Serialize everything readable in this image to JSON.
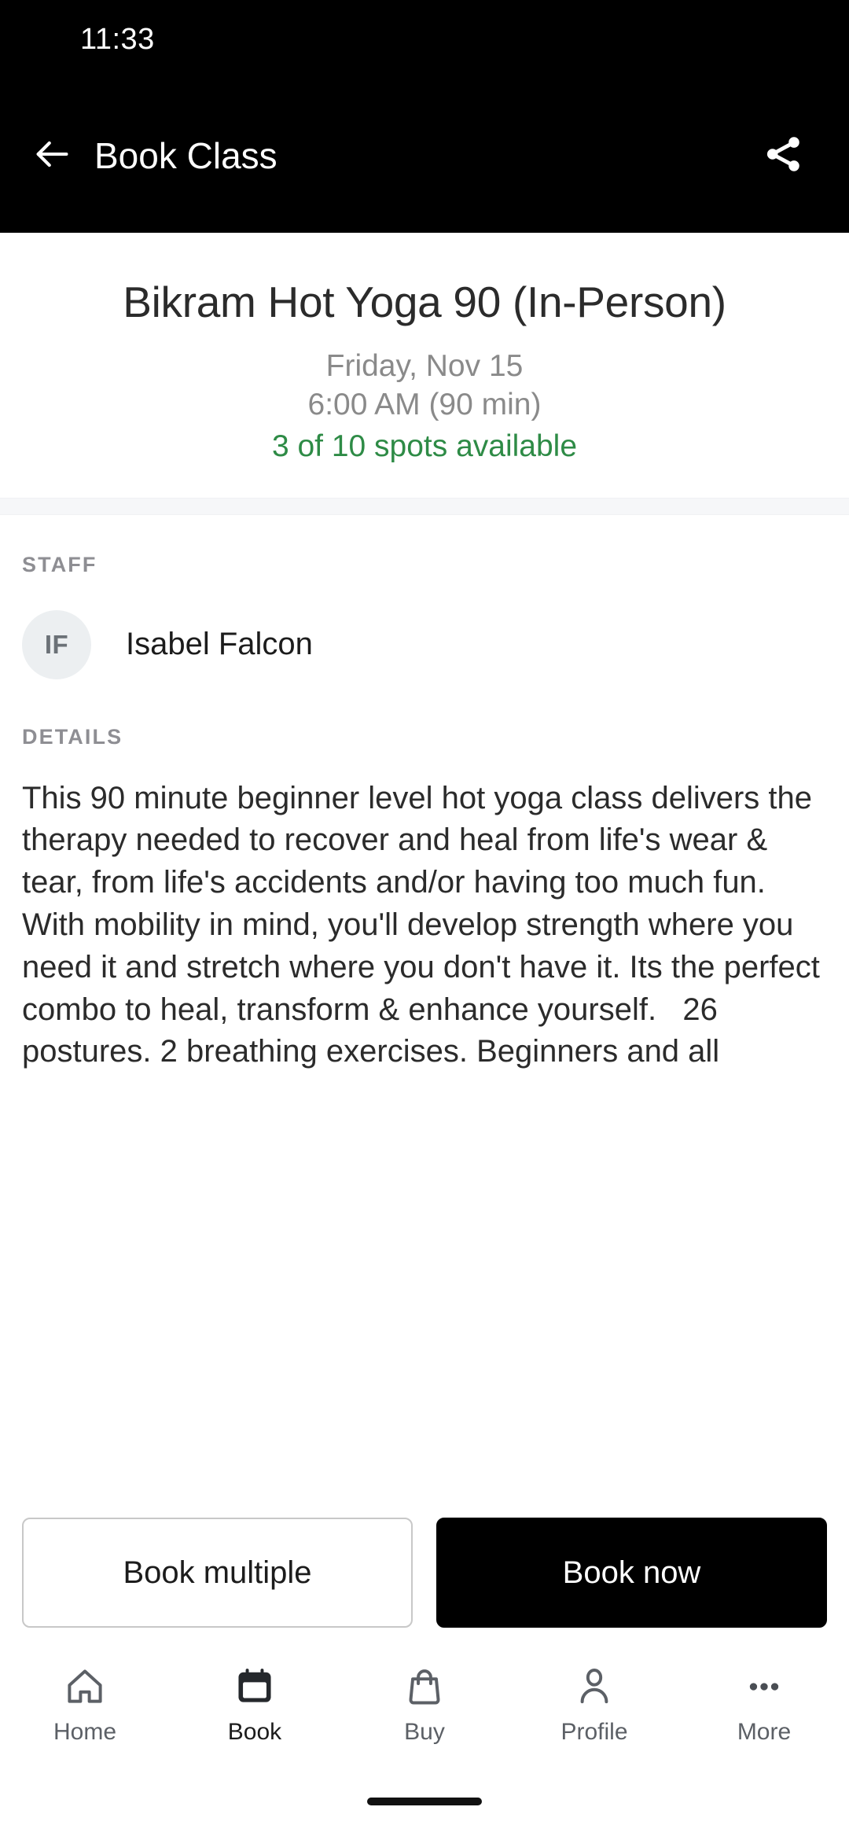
{
  "status_bar": {
    "clock": "11:33"
  },
  "app_bar": {
    "title": "Book Class",
    "back_icon": "back-arrow-icon",
    "share_icon": "share-icon"
  },
  "class_header": {
    "title": "Bikram Hot Yoga 90 (In-Person)",
    "date": "Friday, Nov 15",
    "time": "6:00 AM (90 min)",
    "spots": "3 of 10 spots available",
    "spots_color": "#2e8b46",
    "muted_color": "#8a8a8a"
  },
  "staff": {
    "label": "STAFF",
    "initials": "IF",
    "name": "Isabel Falcon"
  },
  "details": {
    "label": "DETAILS",
    "body": "This 90 minute beginner level hot yoga class delivers the therapy needed to recover and heal from life's wear & tear, from life's accidents and/or having too much fun. With mobility in mind, you'll develop strength where you need it and stretch where you don't have it. Its the perfect combo to heal, transform & enhance yourself.   26 postures. 2 breathing exercises. Beginners and all"
  },
  "actions": {
    "secondary_label": "Book multiple",
    "primary_label": "Book now",
    "primary_bg": "#000000"
  },
  "bottom_nav": {
    "items": [
      {
        "label": "Home",
        "icon": "home-icon",
        "active": false
      },
      {
        "label": "Book",
        "icon": "calendar-icon",
        "active": true
      },
      {
        "label": "Buy",
        "icon": "shopping-bag-icon",
        "active": false
      },
      {
        "label": "Profile",
        "icon": "person-icon",
        "active": false
      },
      {
        "label": "More",
        "icon": "ellipsis-icon",
        "active": false
      }
    ]
  }
}
